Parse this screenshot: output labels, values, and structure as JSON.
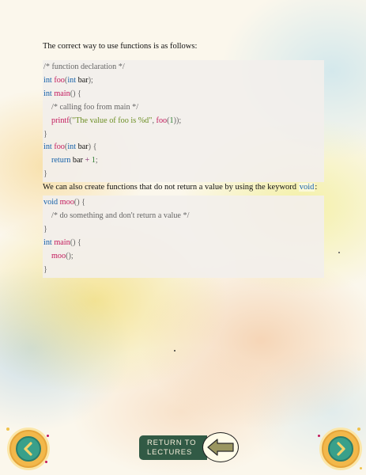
{
  "lesson": {
    "intro": "The correct way to use functions is as follows:",
    "code1": {
      "l1_comment": "/* function declaration */",
      "l2_kw": "int",
      "l2_fn": "foo",
      "l2_p1": "(",
      "l2_kw2": "int",
      "l2_id": " bar",
      "l2_p2": ");",
      "l3_kw": "int",
      "l3_fn": "main",
      "l3_p": "() {",
      "l4_comment": "/* calling foo from main */",
      "l5_fn": "printf",
      "l5_p1": "(",
      "l5_str": "\"The value of foo is %d\"",
      "l5_p2": ", ",
      "l5_fn2": "foo",
      "l5_p3": "(",
      "l5_num": "1",
      "l5_p4": "));",
      "l6_p": "}",
      "l7_kw": "int",
      "l7_fn": "foo",
      "l7_p1": "(",
      "l7_kw2": "int",
      "l7_id": " bar",
      "l7_p2": ") {",
      "l8_kw": "return",
      "l8_id": " bar ",
      "l8_op": "+",
      "l8_num": " 1",
      "l8_p": ";",
      "l9_p": "}"
    },
    "middle_text": "We can also create functions that do not return a value by using the keyword",
    "middle_keyword": "void",
    "middle_colon": ":",
    "code2": {
      "l1_kw": "void",
      "l1_fn": "moo",
      "l1_p": "() {",
      "l2_comment": "/* do something and don't return a value */",
      "l3_p": "}",
      "l4_kw": "int",
      "l4_fn": "main",
      "l4_p": "() {",
      "l5_fn": "moo",
      "l5_p": "();",
      "l6_p": "}"
    }
  },
  "navigation": {
    "prev_icon": "chevron-left",
    "next_icon": "chevron-right",
    "return_line1": "RETURN TO",
    "return_line2": "LECTURES",
    "return_icon": "arrow-left"
  },
  "colors": {
    "keyword": "#1560a8",
    "function": "#c2185b",
    "string": "#6b8e23",
    "nav_teal": "#39a08a",
    "nav_gold": "#f2b84b",
    "return_green": "#315a45"
  }
}
